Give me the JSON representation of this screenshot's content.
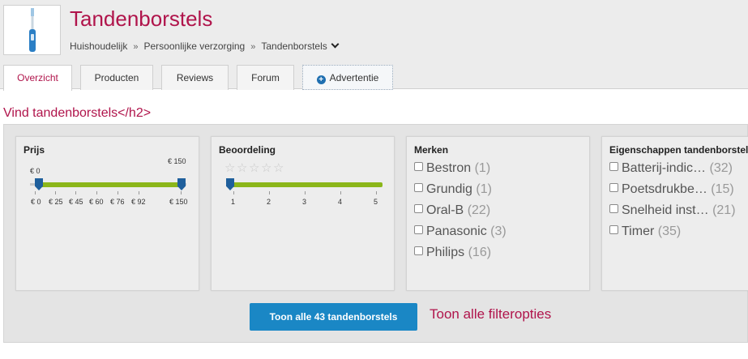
{
  "page": {
    "title": "Tandenborstels",
    "breadcrumb": [
      "Huishoudelijk",
      "Persoonlijke verzorging",
      "Tandenborstels"
    ],
    "breadcrumb_separator": "»"
  },
  "tabs": [
    {
      "label": "Overzicht",
      "active": true
    },
    {
      "label": "Producten"
    },
    {
      "label": "Reviews"
    },
    {
      "label": "Forum"
    },
    {
      "label": "Advertentie",
      "icon": "plus-circle-icon"
    }
  ],
  "section_heading": "Vind tandenborstels</h2>",
  "filters": {
    "price": {
      "title": "Prijs",
      "min_label": "€ 0",
      "max_label": "€ 150",
      "ticks": [
        "€ 0",
        "€ 25",
        "€ 45",
        "€ 60",
        "€ 76",
        "€ 92",
        "€ 150"
      ],
      "range": [
        0,
        150
      ]
    },
    "rating": {
      "title": "Beoordeling",
      "ticks": [
        "1",
        "2",
        "3",
        "4",
        "5"
      ],
      "range": [
        1,
        5
      ]
    },
    "brands": {
      "title": "Merken",
      "items": [
        {
          "name": "Bestron",
          "count": "(1)"
        },
        {
          "name": "Grundig",
          "count": "(1)"
        },
        {
          "name": "Oral-B",
          "count": "(22)"
        },
        {
          "name": "Panasonic",
          "count": "(3)"
        },
        {
          "name": "Philips",
          "count": "(16)"
        }
      ]
    },
    "properties": {
      "title": "Eigenschappen tandenborstel",
      "items": [
        {
          "name": "Batterij-indic…",
          "count": "(32)"
        },
        {
          "name": "Poetsdrukbe…",
          "count": "(15)"
        },
        {
          "name": "Snelheid inst…",
          "count": "(21)"
        },
        {
          "name": "Timer",
          "count": "(35)"
        }
      ]
    }
  },
  "actions": {
    "show_all": "Toon alle 43 tandenborstels",
    "all_filters": "Toon alle filteropties"
  },
  "colors": {
    "brand": "#b0144b",
    "button": "#1a87c5",
    "slider": "#8bb61a"
  }
}
